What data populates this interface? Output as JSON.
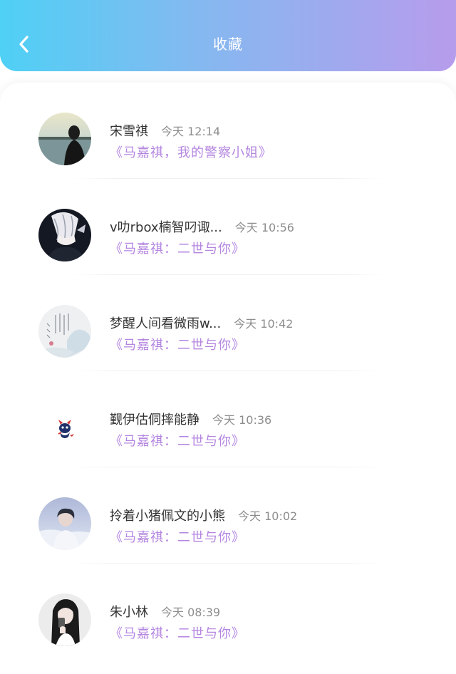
{
  "header": {
    "title": "收藏",
    "back_icon": "chevron-left-icon",
    "gradient_start": "#4fd0f5",
    "gradient_end": "#b79cec"
  },
  "accent_color": "#b486e0",
  "favorites": [
    {
      "name": "宋雪祺",
      "time": "今天 12:14",
      "book": "《马嘉祺，我的警察小姐》",
      "avatar": "lake-silhouette-avatar"
    },
    {
      "name": "v叻rbox楠智叼诹...",
      "time": "今天 10:56",
      "book": "《马嘉祺：二世与你》",
      "avatar": "anime-dark-avatar"
    },
    {
      "name": "梦醒人间看微雨w...",
      "time": "今天 10:42",
      "book": "《马嘉祺：二世与你》",
      "avatar": "calligraphy-avatar"
    },
    {
      "name": "觐伊估侗摔能静",
      "time": "今天 10:36",
      "book": "《马嘉祺：二世与你》",
      "avatar": "little-devil-avatar"
    },
    {
      "name": "拎着小猪佩文的小熊",
      "time": "今天 10:02",
      "book": "《马嘉祺：二世与你》",
      "avatar": "boy-blue-avatar"
    },
    {
      "name": "朱小林",
      "time": "今天 08:39",
      "book": "《马嘉祺：二世与你》",
      "avatar": "girl-phone-avatar"
    }
  ]
}
